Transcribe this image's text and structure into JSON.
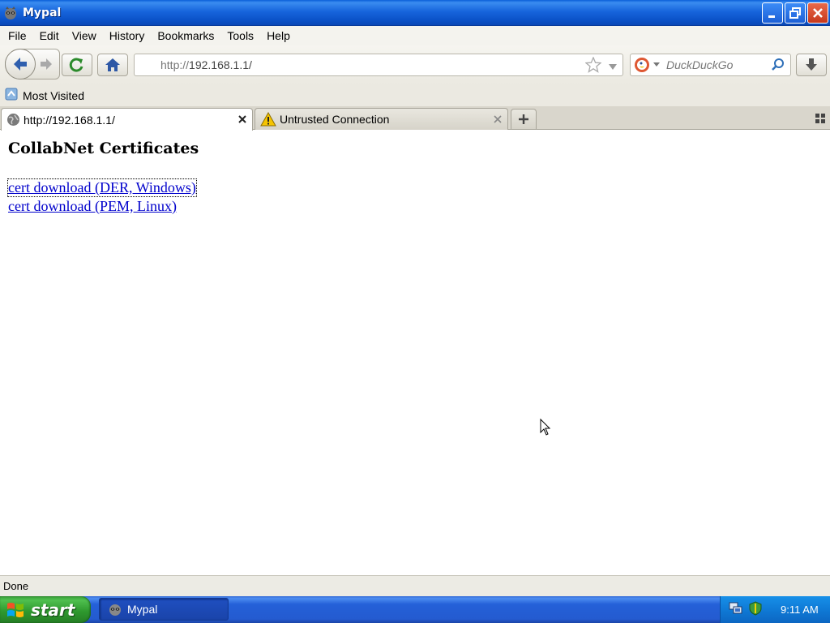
{
  "window": {
    "title": "Mypal"
  },
  "menu": {
    "items": [
      {
        "label": "File"
      },
      {
        "label": "Edit"
      },
      {
        "label": "View"
      },
      {
        "label": "History"
      },
      {
        "label": "Bookmarks"
      },
      {
        "label": "Tools"
      },
      {
        "label": "Help"
      }
    ]
  },
  "nav": {
    "url_scheme": "http://",
    "url_host": "192.168.1.1/",
    "search_engine": "DuckDuckGo",
    "search_placeholder": "DuckDuckGo"
  },
  "bookmarks": {
    "most_visited": "Most Visited"
  },
  "tabs": [
    {
      "label": "http://192.168.1.1/",
      "active": true
    },
    {
      "label": "Untrusted Connection",
      "active": false
    }
  ],
  "page": {
    "title": "CollabNet Certificates",
    "links": [
      {
        "label": "cert download (DER, Windows)"
      },
      {
        "label": "cert download (PEM, Linux)"
      }
    ]
  },
  "status": {
    "text": "Done"
  },
  "taskbar": {
    "start_label": "start",
    "task_label": "Mypal",
    "clock": "9:11 AM"
  },
  "colors": {
    "link": "#0000cc",
    "titlebar": "#0b52c8",
    "start": "#2f9a2f"
  }
}
